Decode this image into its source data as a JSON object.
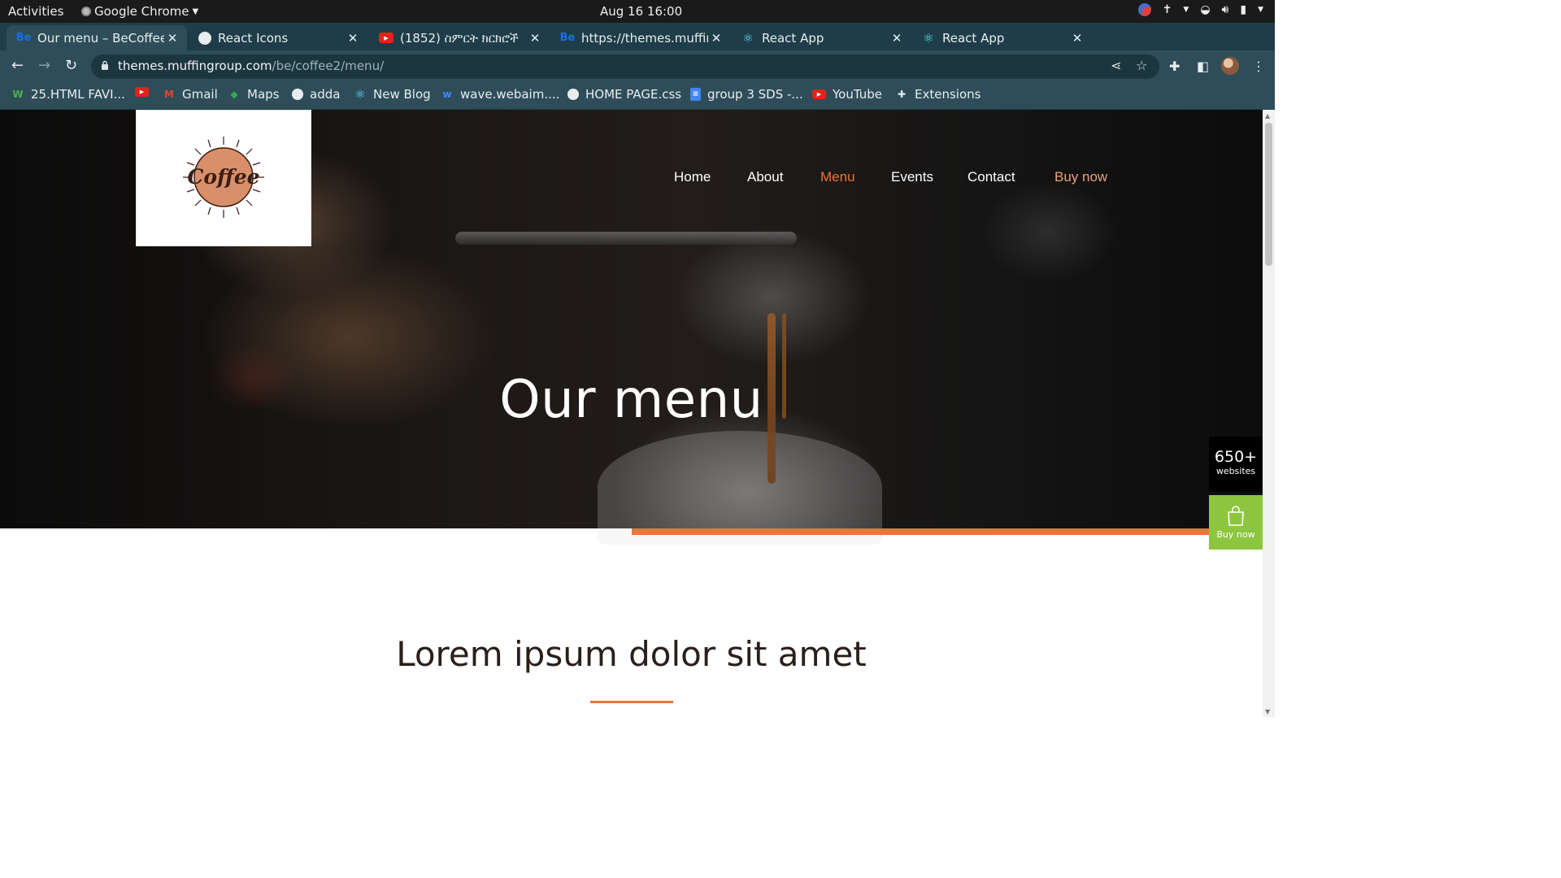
{
  "os": {
    "activities": "Activities",
    "app_name": "Google Chrome",
    "clock": "Aug 16  16:00"
  },
  "tabs": [
    {
      "title": "Our menu – BeCoffee",
      "favicon": "behance-icon",
      "active": true
    },
    {
      "title": "React Icons",
      "favicon": "globe-icon",
      "active": false
    },
    {
      "title": "(1852) ስምርት ክርክሮች",
      "favicon": "youtube-icon",
      "active": false
    },
    {
      "title": "https://themes.muffin",
      "favicon": "behance-icon",
      "active": false
    },
    {
      "title": "React App",
      "favicon": "react-icon",
      "active": false
    },
    {
      "title": "React App",
      "favicon": "react-icon",
      "active": false
    }
  ],
  "address": {
    "host": "themes.muffingroup.com",
    "path": "/be/coffee2/menu/"
  },
  "bookmarks": [
    {
      "label": "25.HTML FAVI...",
      "icon": "w-icon"
    },
    {
      "label": "",
      "icon": "youtube-icon"
    },
    {
      "label": "Gmail",
      "icon": "gmail-icon"
    },
    {
      "label": "Maps",
      "icon": "maps-icon"
    },
    {
      "label": "adda",
      "icon": "globe-icon"
    },
    {
      "label": "New Blog",
      "icon": "react-icon"
    },
    {
      "label": "wave.webaim....",
      "icon": "wave-icon"
    },
    {
      "label": "HOME PAGE.css",
      "icon": "globe-icon"
    },
    {
      "label": "group 3 SDS -...",
      "icon": "docs-icon"
    },
    {
      "label": "YouTube",
      "icon": "youtube-icon"
    },
    {
      "label": "Extensions",
      "icon": "puzzle-icon"
    }
  ],
  "site": {
    "logo_text": "Coffee",
    "nav": [
      {
        "label": "Home",
        "color": "#ffffff"
      },
      {
        "label": "About",
        "color": "#ffffff"
      },
      {
        "label": "Menu",
        "color": "#e8763a"
      },
      {
        "label": "Events",
        "color": "#ffffff"
      },
      {
        "label": "Contact",
        "color": "#ffffff"
      },
      {
        "label": "Buy now",
        "color": "#e9a27a"
      }
    ],
    "hero_title": "Our menu",
    "badge_count": "650+",
    "badge_label": "websites",
    "buy_label": "Buy now",
    "section_title": "Lorem ipsum dolor sit amet",
    "accent": "#e8763a",
    "buy_color": "#8cc63f"
  }
}
